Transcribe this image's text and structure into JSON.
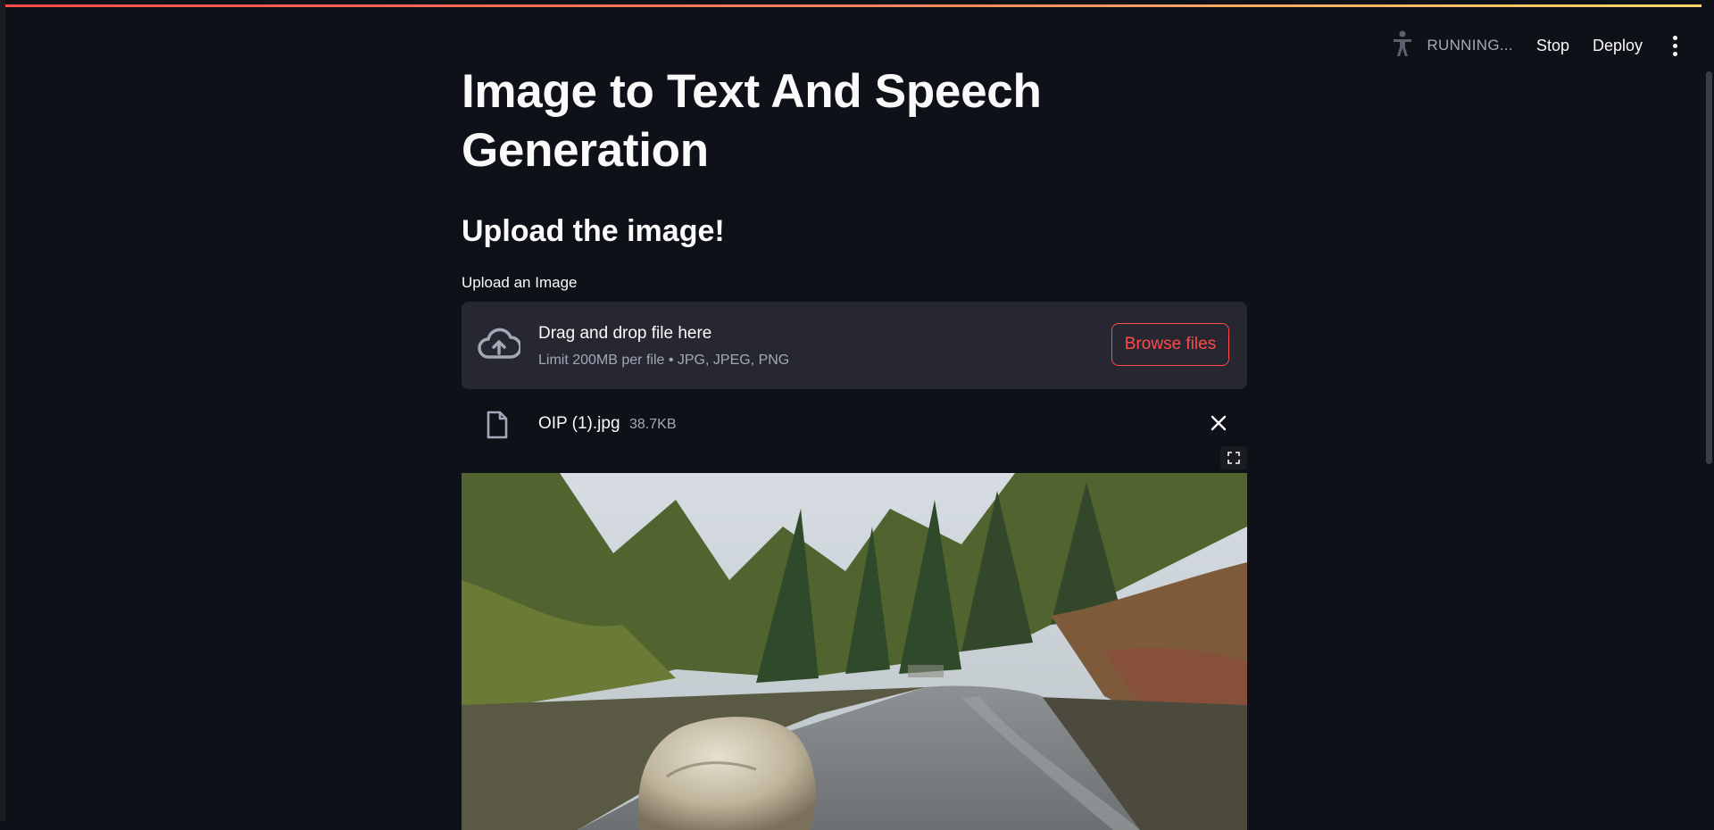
{
  "toolbar": {
    "status": "RUNNING...",
    "stop_label": "Stop",
    "deploy_label": "Deploy",
    "status_icon": "running-person-icon",
    "menu_icon": "kebab-menu-icon"
  },
  "main": {
    "title": "Image to Text And Speech Generation",
    "subheader": "Upload the image!",
    "uploader": {
      "label": "Upload an Image",
      "drop_text": "Drag and drop file here",
      "limit_text": "Limit 200MB per file • JPG, JPEG, PNG",
      "browse_label": "Browse files",
      "icon": "cloud-upload-icon"
    },
    "file": {
      "name": "OIP (1).jpg",
      "size": "38.7KB",
      "icon": "file-icon",
      "remove_icon": "close-icon"
    },
    "image": {
      "fullscreen_icon": "fullscreen-icon"
    }
  },
  "colors": {
    "background": "#0e1117",
    "accent": "#ff4b4b",
    "panel": "#262730",
    "muted_text": "#a3a8b8"
  }
}
